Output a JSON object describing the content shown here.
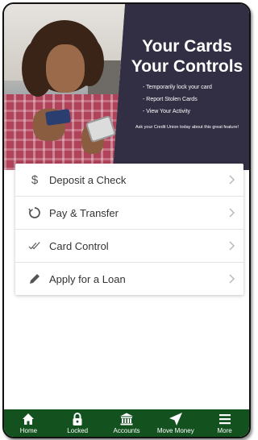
{
  "hero": {
    "title_line1": "Your Cards",
    "title_line2": "Your Controls",
    "bullets": [
      "- Temporarily lock your card",
      "- Report Stolen Cards",
      "- View Your Activity"
    ],
    "footnote": "Ask your Credit Union today about this great feature!"
  },
  "menu": {
    "items": [
      {
        "label": "Deposit a Check",
        "icon": "dollar-icon"
      },
      {
        "label": "Pay & Transfer",
        "icon": "circle-arrows-icon"
      },
      {
        "label": "Card Control",
        "icon": "checkmarks-icon"
      },
      {
        "label": "Apply for a Loan",
        "icon": "pencil-icon"
      }
    ]
  },
  "tabbar": {
    "color": "#13521f",
    "tabs": [
      {
        "label": "Home",
        "icon": "home-icon"
      },
      {
        "label": "Locked",
        "icon": "lock-icon"
      },
      {
        "label": "Accounts",
        "icon": "bank-icon"
      },
      {
        "label": "Move Money",
        "icon": "send-icon"
      },
      {
        "label": "More",
        "icon": "menu-icon"
      }
    ]
  }
}
